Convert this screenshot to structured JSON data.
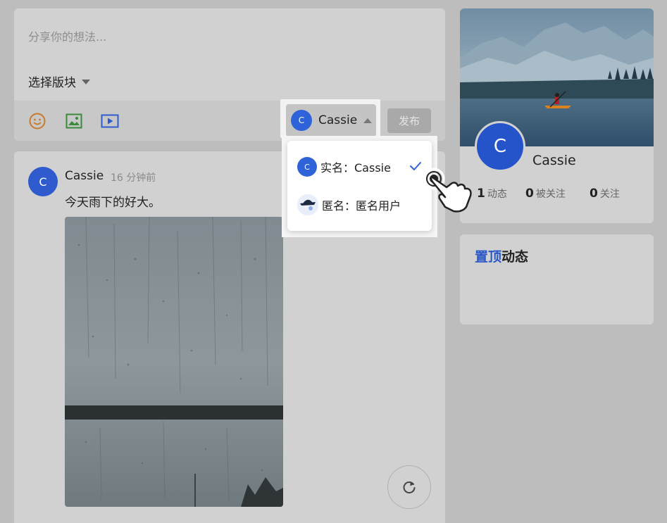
{
  "composer": {
    "placeholder": "分享你的想法...",
    "section_select_label": "选择版块",
    "identity": {
      "avatar_letter": "C",
      "name": "Cassie"
    },
    "publish_label": "发布",
    "tools": [
      "emoji-icon",
      "image-icon",
      "video-icon"
    ]
  },
  "identity_dropdown": {
    "items": [
      {
        "avatar_letter": "C",
        "label": "实名：Cassie",
        "selected": true
      },
      {
        "avatar_letter": "",
        "label": "匿名：匿名用户",
        "selected": false
      }
    ]
  },
  "post": {
    "avatar_letter": "C",
    "author": "Cassie",
    "time": "16 分钟前",
    "text": "今天雨下的好大。"
  },
  "profile": {
    "avatar_letter": "C",
    "name": "Cassie",
    "stats": [
      {
        "value": "1",
        "label": "动态"
      },
      {
        "value": "0",
        "label": "被关注"
      },
      {
        "value": "0",
        "label": "关注"
      }
    ]
  },
  "pinned": {
    "title_highlight": "置顶",
    "title_rest": "动态"
  },
  "colors": {
    "accent": "#2f63d9",
    "check": "#2f63d9",
    "emoji": "#c87a2a",
    "image_icon": "#3a8a3a",
    "video_icon": "#2f5bcf"
  }
}
